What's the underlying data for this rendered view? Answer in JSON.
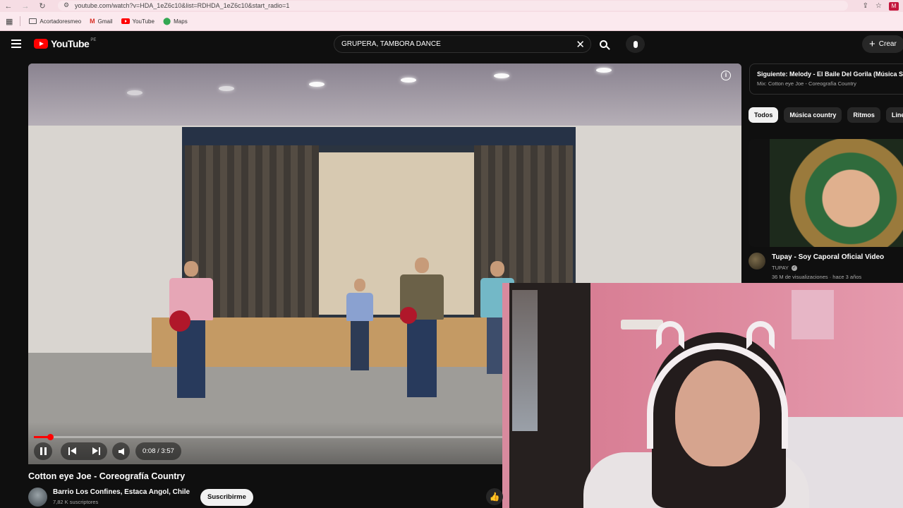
{
  "browser": {
    "url": "youtube.com/watch?v=HDA_1eZ6c10&list=RDHDA_1eZ6c10&start_radio=1",
    "profile_initial": "M"
  },
  "bookmarks": [
    {
      "label": "Acortadoresmeo",
      "icon": "folder-icon"
    },
    {
      "label": "Gmail",
      "icon": "gmail-icon"
    },
    {
      "label": "YouTube",
      "icon": "youtube-icon"
    },
    {
      "label": "Maps",
      "icon": "maps-icon"
    }
  ],
  "youtube": {
    "logo_text": "YouTube",
    "logo_country": "PE",
    "search_query": "GRUPERA, TAMBORA DANCE",
    "create_label": "Crear"
  },
  "player": {
    "time_display": "0:08 / 3:57",
    "progress_fraction": 0.034
  },
  "video": {
    "title": "Cotton eye Joe - Coreografía Country",
    "channel": "Barrio Los Confines, Estaca Angol, Chile",
    "subscribers": "7,82 K suscriptores",
    "subscribe_label": "Suscribirme"
  },
  "sidebar": {
    "next_up": "Siguiente: Melody - El Baile Del Gorila (Música Si (",
    "mix_label": "Mix: Cotton eye Joe - Coreografía Country",
    "chips": [
      "Todos",
      "Música country",
      "Ritmos",
      "Line d"
    ],
    "recommendation": {
      "title": "Tupay - Soy Caporal Oficial Video",
      "channel": "TUPAY",
      "meta": "36 M de visualizaciones · hace 3 años"
    }
  },
  "colors": {
    "accent_red": "#ff0000",
    "background": "#0f0f0f",
    "chip_active": "#f1f1f1"
  }
}
